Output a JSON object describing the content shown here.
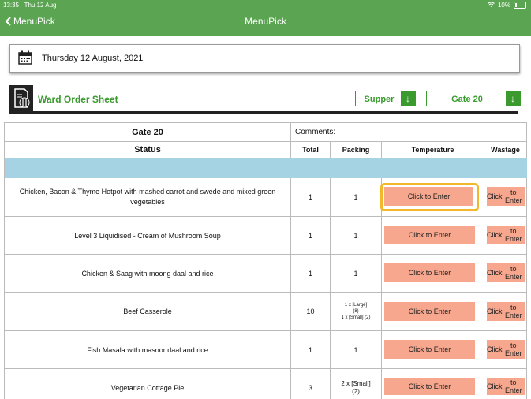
{
  "status_bar": {
    "time": "13:35",
    "date": "Thu 12 Aug",
    "battery": "10%"
  },
  "nav": {
    "back_label": "MenuPick",
    "title": "MenuPick"
  },
  "date_text": "Thursday 12 August, 2021",
  "sheet": {
    "title": "Ward Order Sheet",
    "meal": "Supper",
    "ward": "Gate 20"
  },
  "table": {
    "ward_header": "Gate 20",
    "comments_label": "Comments:",
    "status_header": "Status",
    "total_header": "Total",
    "packing_header": "Packing",
    "temperature_header": "Temperature",
    "wastage_header": "Wastage",
    "temp_button": "Click to Enter",
    "waste_button_line1": "Click",
    "waste_button_line2": "to Enter",
    "rows": [
      {
        "item": "Chicken, Bacon & Thyme Hotpot with mashed carrot and swede and mixed green vegetables",
        "total": "1",
        "packing": "1"
      },
      {
        "item": "Level 3 Liquidised - Cream of Mushroom Soup",
        "total": "1",
        "packing": "1"
      },
      {
        "item": "Chicken & Saag with moong daal and rice",
        "total": "1",
        "packing": "1"
      },
      {
        "item": "Beef Casserole",
        "total": "10",
        "packing_lines": [
          "1 x [Large]",
          "(8)",
          "1 x [Small] (2)"
        ]
      },
      {
        "item": "Fish Masala with masoor daal and rice",
        "total": "1",
        "packing": "1"
      },
      {
        "item": "Vegetarian Cottage Pie",
        "total": "3",
        "packing_lines": [
          "2 x [Small]",
          "(2)"
        ]
      }
    ]
  },
  "colors": {
    "header_green": "#5ba552",
    "accent_green": "#3a9a2e",
    "button_salmon": "#f7a78e",
    "band_blue": "#a6d3e3",
    "highlight": "#f2b82b"
  }
}
